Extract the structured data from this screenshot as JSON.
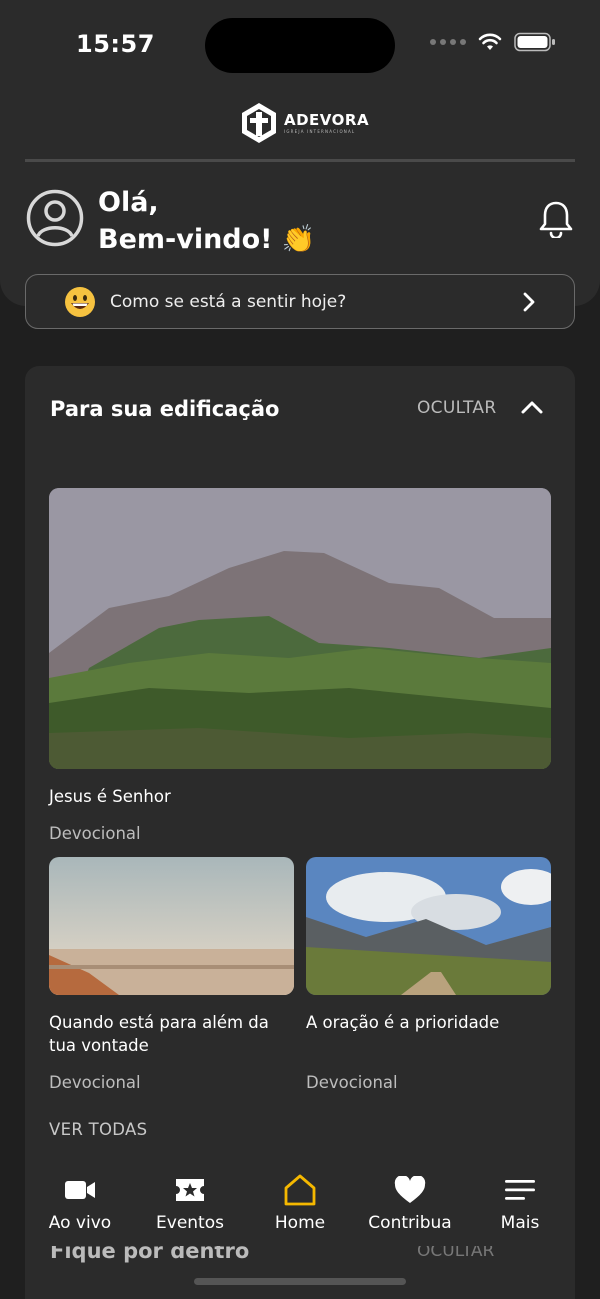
{
  "status": {
    "time": "15:57"
  },
  "brand": {
    "name": "ADEVORA",
    "tagline": "IGREJA INTERNACIONAL"
  },
  "greeting": {
    "line1": "Olá,",
    "line2": "Bem-vindo! 👏"
  },
  "mood": {
    "emoji": "grinning-face-icon",
    "prompt": "Como se está a sentir hoje?"
  },
  "edification": {
    "title": "Para sua edificação",
    "hide_label": "OCULTAR",
    "featured": {
      "title": "Jesus é Senhor",
      "category": "Devocional"
    },
    "items": [
      {
        "title": " Quando está para além da tua vontade",
        "category": "Devocional"
      },
      {
        "title": "A oração é a prioridade",
        "category": "Devocional"
      }
    ],
    "see_all": "VER TODAS"
  },
  "next_section": {
    "title": "Fique por dentro",
    "hide_label": "OCULTAR"
  },
  "tabs": [
    {
      "label": "Ao vivo",
      "icon": "video-camera-icon"
    },
    {
      "label": "Eventos",
      "icon": "ticket-star-icon"
    },
    {
      "label": "Home",
      "icon": "home-icon",
      "active": true
    },
    {
      "label": "Contribua",
      "icon": "heart-icon"
    },
    {
      "label": "Mais",
      "icon": "menu-icon"
    }
  ],
  "colors": {
    "background": "#1f1f1f",
    "surface": "#2b2b2b",
    "accent": "#f5b800"
  }
}
